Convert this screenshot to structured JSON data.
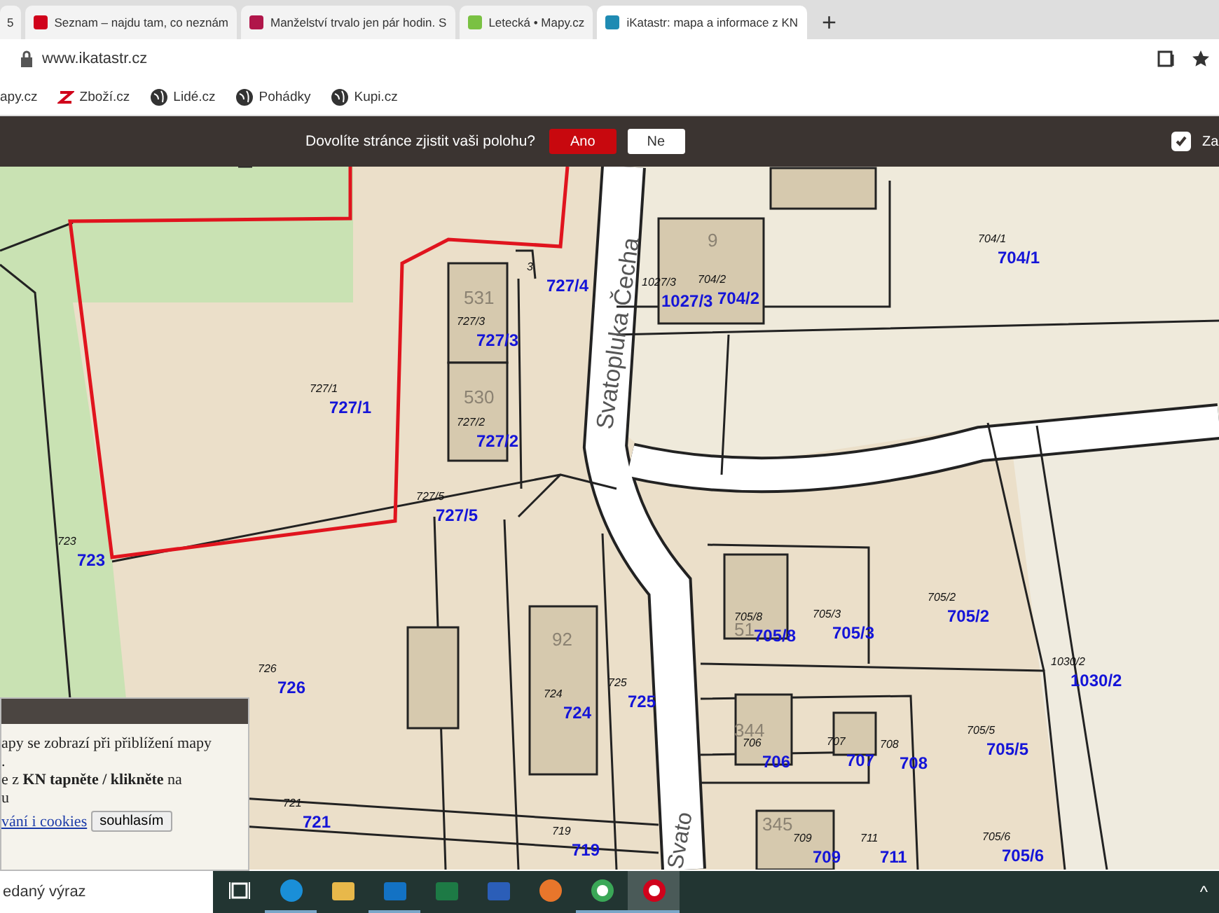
{
  "browser": {
    "tabs": [
      {
        "title": "5",
        "selected": false
      },
      {
        "title": "Seznam – najdu tam, co neznám",
        "selected": false
      },
      {
        "title": "Manželství trvalo jen pár hodin. S",
        "selected": false
      },
      {
        "title": "Letecká • Mapy.cz",
        "selected": false
      },
      {
        "title": "iKatastr: mapa a informace z KN",
        "selected": true
      }
    ],
    "new_tab": "+",
    "address": "www.ikatastr.cz",
    "bookmarks": [
      "apy.cz",
      "Zboží.cz",
      "Lidé.cz",
      "Pohádky",
      "Kupi.cz"
    ]
  },
  "location_prompt": {
    "question": "Dovolíte stránce zjistit vaši polohu?",
    "buttons": [
      {
        "label": "Ano",
        "kind": "primary"
      },
      {
        "label": "Ne",
        "kind": "secondary"
      }
    ],
    "option": {
      "label": "Za",
      "checked": true
    }
  },
  "map": {
    "streets": [
      "Svatopluka Čecha",
      "Svato"
    ],
    "buildings": [
      "531",
      "530",
      "92",
      "344",
      "345",
      "9",
      "51"
    ],
    "parcels": [
      {
        "label": "727/4",
        "small": "3"
      },
      {
        "label": "1027/3",
        "small": "1027/3"
      },
      {
        "label": "704/2",
        "small": "704/2"
      },
      {
        "label": "704/1",
        "small": "704/1"
      },
      {
        "label": "727/3",
        "small": "727/3"
      },
      {
        "label": "727/1",
        "small": "727/1"
      },
      {
        "label": "727/2",
        "small": "727/2"
      },
      {
        "label": "727/5",
        "small": "727/5"
      },
      {
        "label": "723",
        "small": "723"
      },
      {
        "label": "705/2",
        "small": "705/2"
      },
      {
        "label": "705/8",
        "small": "705/8"
      },
      {
        "label": "705/3",
        "small": "705/3"
      },
      {
        "label": "1030/2",
        "small": "1030/2"
      },
      {
        "label": "726",
        "small": "726"
      },
      {
        "label": "724",
        "small": "724"
      },
      {
        "label": "725",
        "small": "725"
      },
      {
        "label": "706",
        "small": "706"
      },
      {
        "label": "707",
        "small": "707"
      },
      {
        "label": "708",
        "small": "708"
      },
      {
        "label": "705/5",
        "small": "705/5"
      },
      {
        "label": "721",
        "small": "721"
      },
      {
        "label": "719",
        "small": "719"
      },
      {
        "label": "709",
        "small": "709"
      },
      {
        "label": "711",
        "small": "711"
      },
      {
        "label": "705/6",
        "small": "705/6"
      }
    ]
  },
  "cookie_notice": {
    "lines": [
      "apy se zobrazí při přiblížení mapy",
      ".",
      "e z **KN tapněte / klikněte** na",
      "u"
    ],
    "link": "vání i cookies",
    "button": "souhlasím"
  },
  "search": {
    "placeholder": "edaný výraz"
  },
  "taskbar": {
    "apps": [
      {
        "kind": "taskview",
        "running": false
      },
      {
        "kind": "edge",
        "running": true
      },
      {
        "kind": "files",
        "running": false
      },
      {
        "kind": "outlook",
        "running": true
      },
      {
        "kind": "excel",
        "running": false
      },
      {
        "kind": "word",
        "running": false
      },
      {
        "kind": "firefox",
        "running": false
      },
      {
        "kind": "chrome",
        "running": true
      },
      {
        "kind": "seznam",
        "running": true,
        "selected": true
      }
    ],
    "tray": "^"
  }
}
